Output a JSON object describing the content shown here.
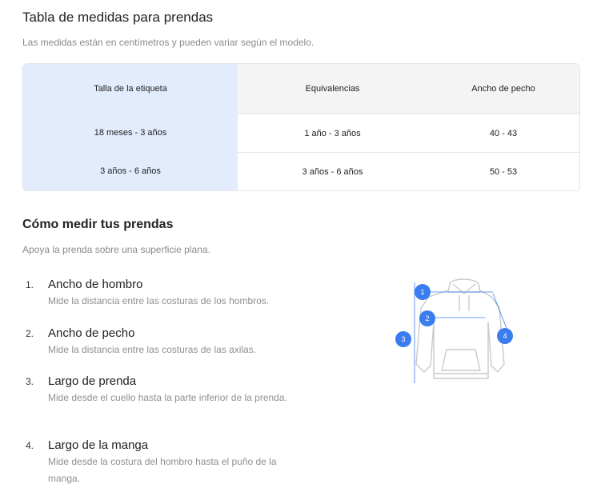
{
  "header": {
    "title": "Tabla de medidas para prendas",
    "subtitle": "Las medidas están en centímetros y pueden variar según el modelo."
  },
  "table": {
    "columns": [
      "Talla de la etiqueta",
      "Equivalencias",
      "Ancho de pecho"
    ],
    "rows": [
      [
        "18 meses - 3 años",
        "1 año - 3 años",
        "40 - 43"
      ],
      [
        "3 años - 6 años",
        "3 años - 6 años",
        "50 - 53"
      ]
    ],
    "accent_color": "#e3ecfd"
  },
  "measure": {
    "title": "Cómo medir tus prendas",
    "description": "Apoya la prenda sobre una superficie plana.",
    "steps": [
      {
        "number": "1.",
        "title": "Ancho de hombro",
        "description": "Mide la distancia entre las costuras de los hombros."
      },
      {
        "number": "2.",
        "title": "Ancho de pecho",
        "description": "Mide la distancia entre las costuras de las axilas."
      },
      {
        "number": "3.",
        "title": "Largo de prenda",
        "description": "Mide desde el cuello hasta la parte inferior de la prenda."
      },
      {
        "number": "4.",
        "title": "Largo de la manga",
        "description": "Mide desde la costura del hombro hasta el puño de la manga."
      }
    ]
  },
  "diagram": {
    "icon": "hoodie-measurement-icon",
    "badges": [
      "1",
      "2",
      "3",
      "4"
    ],
    "badge_color": "#3b7cf0"
  }
}
